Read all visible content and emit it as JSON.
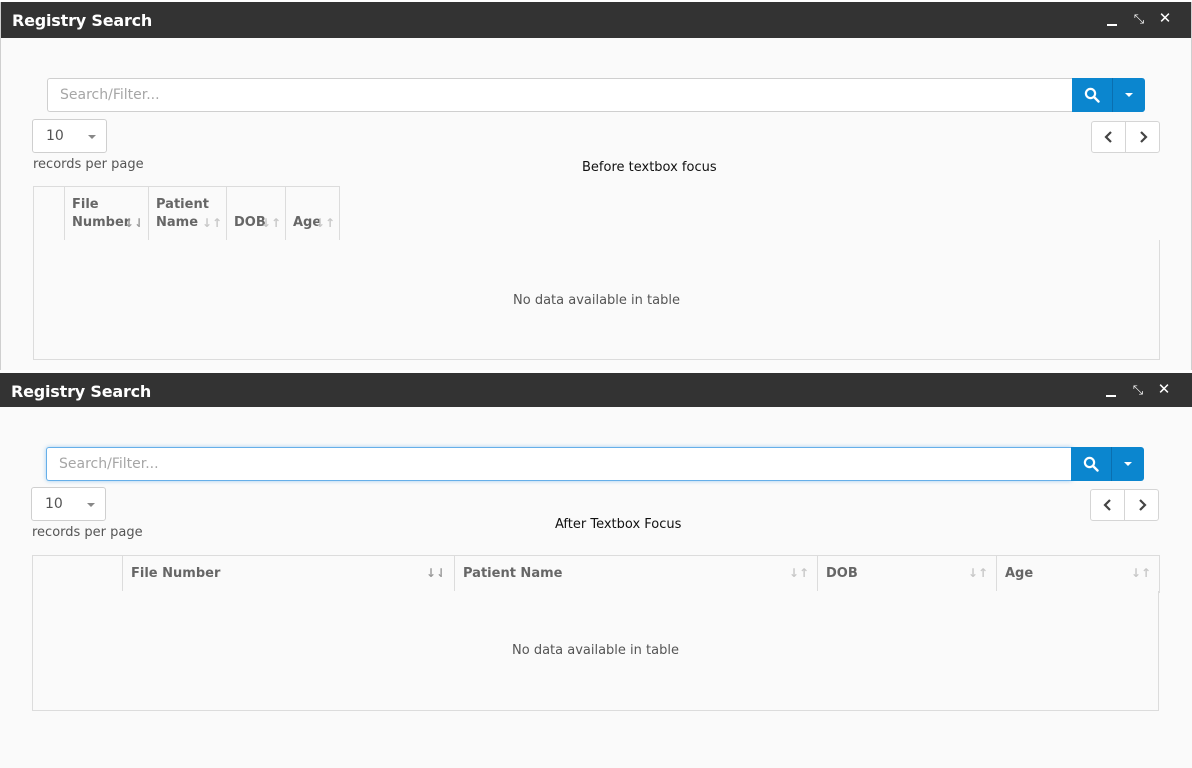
{
  "panels": [
    {
      "title": "Registry Search",
      "search_placeholder": "Search/Filter...",
      "page_size": "10",
      "records_per_page_label": "records per page",
      "caption": "Before textbox focus",
      "columns": [
        "File Number",
        "Patient Name",
        "DOB",
        "Age"
      ],
      "empty_message": "No data available in table"
    },
    {
      "title": "Registry Search",
      "search_placeholder": "Search/Filter...",
      "page_size": "10",
      "records_per_page_label": "records per page",
      "caption": "After Textbox Focus",
      "columns": [
        "File Number",
        "Patient Name",
        "DOB",
        "Age"
      ],
      "empty_message": "No data available in table"
    }
  ],
  "icons": {
    "minimize": "minimize-icon",
    "restore": "restore-icon",
    "close": "close-icon",
    "search": "search-icon",
    "dropdown": "caret-down-icon",
    "sort_active": "sort-numeric-icon",
    "sort_inactive": "sort-icon",
    "prev": "chevron-left-icon",
    "next": "chevron-right-icon"
  },
  "colors": {
    "titlebar": "#333333",
    "primary_button": "#0b86cf",
    "focus_border": "#66afe9"
  }
}
